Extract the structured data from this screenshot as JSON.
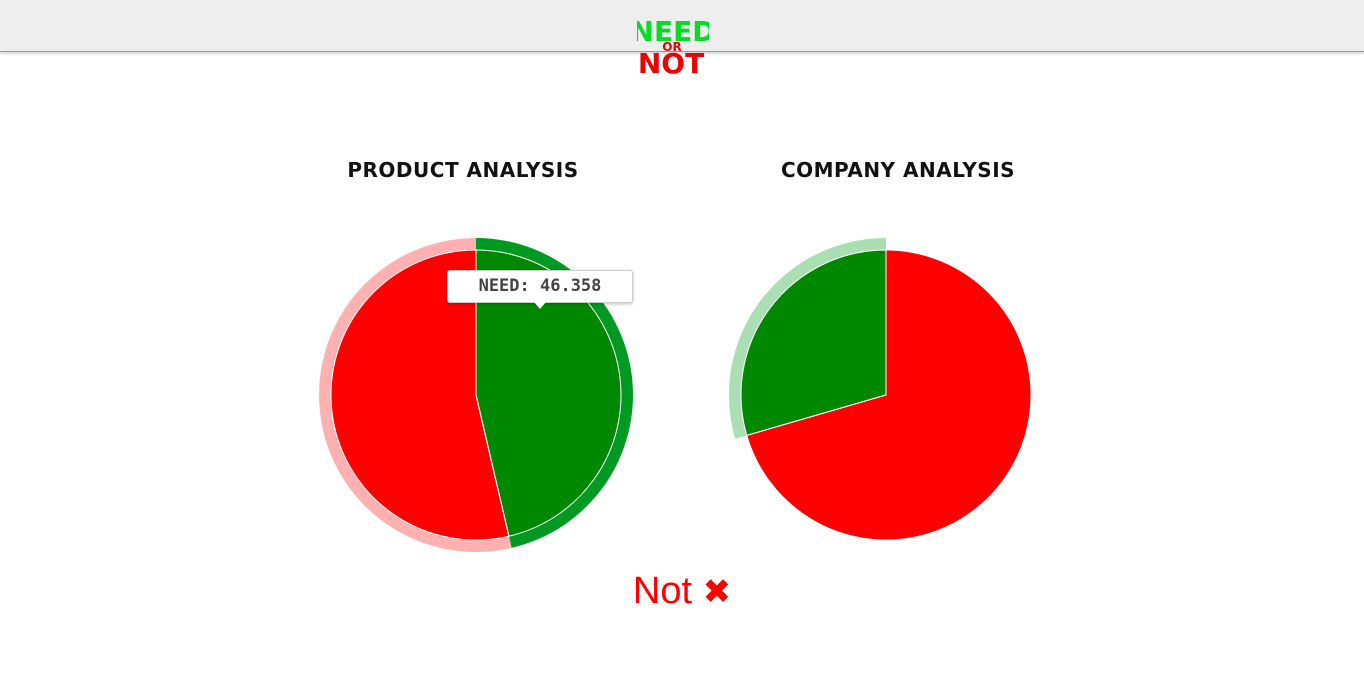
{
  "logo": {
    "line1": "NEED",
    "line2": "OR",
    "line3": "NOT",
    "colors": {
      "need": "#00dd22",
      "not": "#ee0000"
    }
  },
  "tooltip": {
    "text": "NEED: 46.358"
  },
  "verdict": {
    "label": "Not",
    "icon": "heavy-x-icon",
    "glyph": "✖",
    "color": "#ff0000"
  },
  "colors": {
    "need": "#008800",
    "not": "#ff0000",
    "need_hover": "#009922",
    "need_halo": "#a9dfb3",
    "not_halo": "#ffb1b1"
  },
  "chart_data": [
    {
      "type": "pie",
      "title": "Product Analysis",
      "slices": [
        {
          "label": "Need",
          "value": 46.358,
          "color": "#008800",
          "highlighted": true
        },
        {
          "label": "Not",
          "value": 53.642,
          "color": "#ff0000",
          "highlighted": false
        }
      ]
    },
    {
      "type": "pie",
      "title": "Company Analysis",
      "slices": [
        {
          "label": "Need",
          "value": 29.5,
          "color": "#008800",
          "highlighted": false
        },
        {
          "label": "Not",
          "value": 70.5,
          "color": "#ff0000",
          "highlighted": false
        }
      ]
    }
  ]
}
